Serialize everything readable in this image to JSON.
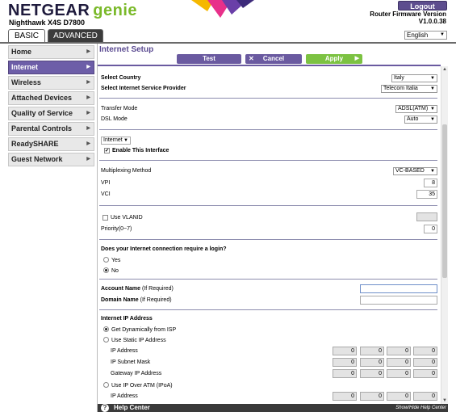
{
  "header": {
    "brand": "NETGEAR",
    "genie": "genie",
    "model": "Nighthawk X4S D7800",
    "logout_label": "Logout",
    "firmware_label": "Router Firmware Version",
    "firmware_version": "V1.0.0.38",
    "language": "English",
    "brand_color": "#1e1a3c",
    "accent_color": "#6d5ea8",
    "apply_color": "#7cc242"
  },
  "tabs": {
    "basic": "BASIC",
    "advanced": "ADVANCED"
  },
  "sidebar": {
    "items": [
      {
        "label": "Home",
        "active": false
      },
      {
        "label": "Internet",
        "active": true
      },
      {
        "label": "Wireless",
        "active": false
      },
      {
        "label": "Attached Devices",
        "active": false
      },
      {
        "label": "Quality of Service",
        "active": false
      },
      {
        "label": "Parental Controls",
        "active": false
      },
      {
        "label": "ReadySHARE",
        "active": false
      },
      {
        "label": "Guest Network",
        "active": false
      }
    ]
  },
  "main": {
    "title": "Internet Setup",
    "buttons": {
      "test": "Test",
      "cancel": "Cancel",
      "apply": "Apply"
    },
    "select_country_label": "Select Country",
    "country": "Italy",
    "isp_label": "Select Internet Service Provider",
    "isp": "Telecom Italia",
    "transfer_mode_label": "Transfer Mode",
    "transfer_mode": "ADSL(ATM)",
    "dsl_mode_label": "DSL Mode",
    "dsl_mode": "Auto",
    "interface_select": "Internet",
    "enable_interface_label": "Enable This Interface",
    "multiplexing_label": "Multiplexing Method",
    "multiplexing": "VC-BASED",
    "vpi_label": "VPI",
    "vpi": "8",
    "vci_label": "VCI",
    "vci": "35",
    "use_vlanid_label": "Use VLANID",
    "priority_label": "Priority(0~7)",
    "priority": "0",
    "login_question": "Does your Internet connection require a login?",
    "yes_label": "Yes",
    "no_label": "No",
    "account_name_label": "Account Name",
    "account_name_hint": "(If Required)",
    "domain_name_label": "Domain Name",
    "domain_name_hint": "(If Required)",
    "ip_section_label": "Internet IP Address",
    "get_dynamic_label": "Get Dynamically from ISP",
    "use_static_label": "Use Static IP Address",
    "ip_address_label": "IP Address",
    "subnet_label": "IP Subnet Mask",
    "gateway_label": "Gateway IP Address",
    "ipoa_label": "Use IP Over ATM (IPoA)",
    "ipoa_ip_label": "IP Address",
    "octet": "0"
  },
  "help": {
    "label": "Help Center",
    "toggle": "Show/Hide Help Center",
    "icon": "question-icon"
  }
}
